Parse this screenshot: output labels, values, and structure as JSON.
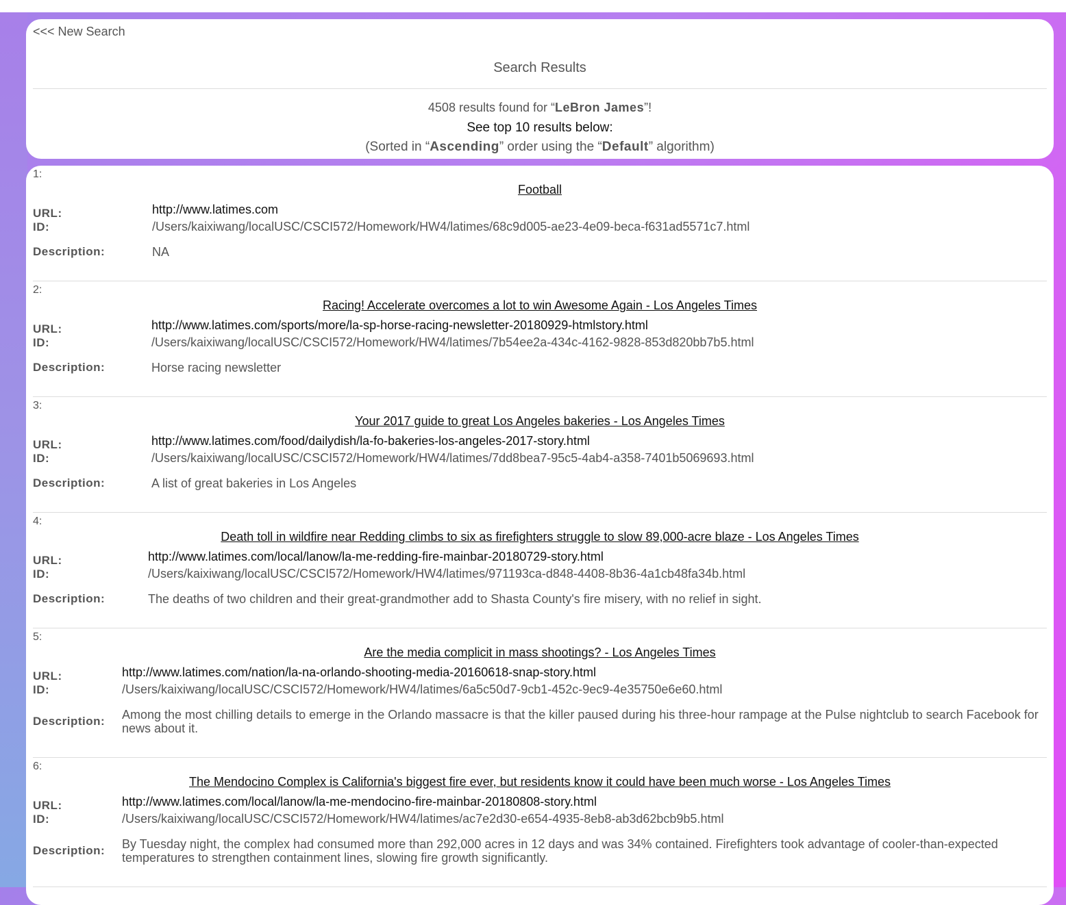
{
  "nav": {
    "new_search": "<<< New Search"
  },
  "header": {
    "title": "Search Results",
    "count": "4508",
    "count_suffix": " results found for “",
    "query": "LeBron James",
    "query_suffix": "”!",
    "see_top": "See top 10 results below:",
    "sorted_prefix": "(Sorted in “",
    "order": "Ascending",
    "sorted_mid": "” order using the “",
    "algorithm": "Default",
    "sorted_suffix": "” algorithm)"
  },
  "labels": {
    "url": "URL:",
    "id": "ID:",
    "description": "Description:"
  },
  "results": [
    {
      "num": "1:",
      "title": "Football",
      "url": "http://www.latimes.com",
      "id": "/Users/kaixiwang/localUSC/CSCI572/Homework/HW4/latimes/68c9d005-ae23-4e09-beca-f631ad5571c7.html",
      "description": "NA"
    },
    {
      "num": "2:",
      "title": "Racing! Accelerate overcomes a lot to win Awesome Again - Los Angeles Times",
      "url": "http://www.latimes.com/sports/more/la-sp-horse-racing-newsletter-20180929-htmlstory.html",
      "id": "/Users/kaixiwang/localUSC/CSCI572/Homework/HW4/latimes/7b54ee2a-434c-4162-9828-853d820bb7b5.html",
      "description": "Horse racing newsletter"
    },
    {
      "num": "3:",
      "title": "Your 2017 guide to great Los Angeles bakeries - Los Angeles Times",
      "url": "http://www.latimes.com/food/dailydish/la-fo-bakeries-los-angeles-2017-story.html",
      "id": "/Users/kaixiwang/localUSC/CSCI572/Homework/HW4/latimes/7dd8bea7-95c5-4ab4-a358-7401b5069693.html",
      "description": "A list of great bakeries in Los Angeles"
    },
    {
      "num": "4:",
      "title": "Death toll in wildfire near Redding climbs to six as firefighters struggle to slow 89,000-acre blaze - Los Angeles Times",
      "url": "http://www.latimes.com/local/lanow/la-me-redding-fire-mainbar-20180729-story.html",
      "id": "/Users/kaixiwang/localUSC/CSCI572/Homework/HW4/latimes/971193ca-d848-4408-8b36-4a1cb48fa34b.html",
      "description": "The deaths of two children and their great-grandmother add to Shasta County's fire misery, with no relief in sight."
    },
    {
      "num": "5:",
      "title": "Are the media complicit in mass shootings? - Los Angeles Times",
      "url": "http://www.latimes.com/nation/la-na-orlando-shooting-media-20160618-snap-story.html",
      "id": "/Users/kaixiwang/localUSC/CSCI572/Homework/HW4/latimes/6a5c50d7-9cb1-452c-9ec9-4e35750e6e60.html",
      "description": "Among the most chilling details to emerge in the Orlando massacre is that the killer paused during his three-hour rampage at the Pulse nightclub to search Facebook for news about it."
    },
    {
      "num": "6:",
      "title": "The Mendocino Complex is California's biggest fire ever, but residents know it could have been much worse - Los Angeles Times",
      "url": "http://www.latimes.com/local/lanow/la-me-mendocino-fire-mainbar-20180808-story.html",
      "id": "/Users/kaixiwang/localUSC/CSCI572/Homework/HW4/latimes/ac7e2d30-e654-4935-8eb8-ab3d62bcb9b5.html",
      "description": "By Tuesday night, the complex had consumed more than 292,000 acres in 12 days and was 34% contained. Firefighters took advantage of cooler-than-expected temperatures to strengthen containment lines, slowing fire growth significantly."
    }
  ]
}
